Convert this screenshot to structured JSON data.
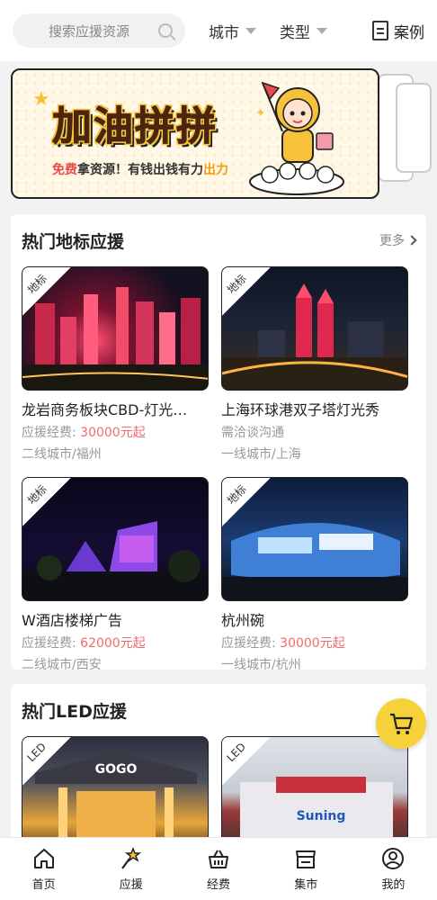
{
  "topbar": {
    "search_placeholder": "搜索应援资源",
    "filter_city": "城市",
    "filter_type": "类型",
    "case_label": "案例"
  },
  "banner": {
    "title": "加油拼拼",
    "sub_free": "免费",
    "sub_mid": "拿资源！有钱出钱有力",
    "sub_end": "出力"
  },
  "sections": {
    "landmark": {
      "title": "热门地标应援",
      "more": "更多",
      "items": [
        {
          "tag": "地标",
          "title": "龙岩商务板块CBD-灯光…",
          "price_label": "应援经费: ",
          "price": "30000元起",
          "location": "二线城市/福州"
        },
        {
          "tag": "地标",
          "title": "上海环球港双子塔灯光秀",
          "price_label": "需洽谈沟通",
          "price": "",
          "location": "一线城市/上海"
        },
        {
          "tag": "地标",
          "title": "W酒店楼梯广告",
          "price_label": "应援经费: ",
          "price": "62000元起",
          "location": "二线城市/西安"
        },
        {
          "tag": "地标",
          "title": "杭州碗",
          "price_label": "应援经费: ",
          "price": "30000元起",
          "location": "一线城市/杭州"
        }
      ]
    },
    "led": {
      "title": "热门LED应援",
      "items": [
        {
          "tag": "LED",
          "sign": "GOGO"
        },
        {
          "tag": "LED",
          "sign": "Suning"
        }
      ]
    }
  },
  "nav": [
    {
      "label": "首页",
      "icon": "home-icon"
    },
    {
      "label": "应援",
      "icon": "star-wand-icon"
    },
    {
      "label": "经费",
      "icon": "basket-icon"
    },
    {
      "label": "集市",
      "icon": "market-icon"
    },
    {
      "label": "我的",
      "icon": "user-icon"
    }
  ],
  "colors": {
    "accent": "#f7d13a",
    "price": "#ef6b6b"
  }
}
